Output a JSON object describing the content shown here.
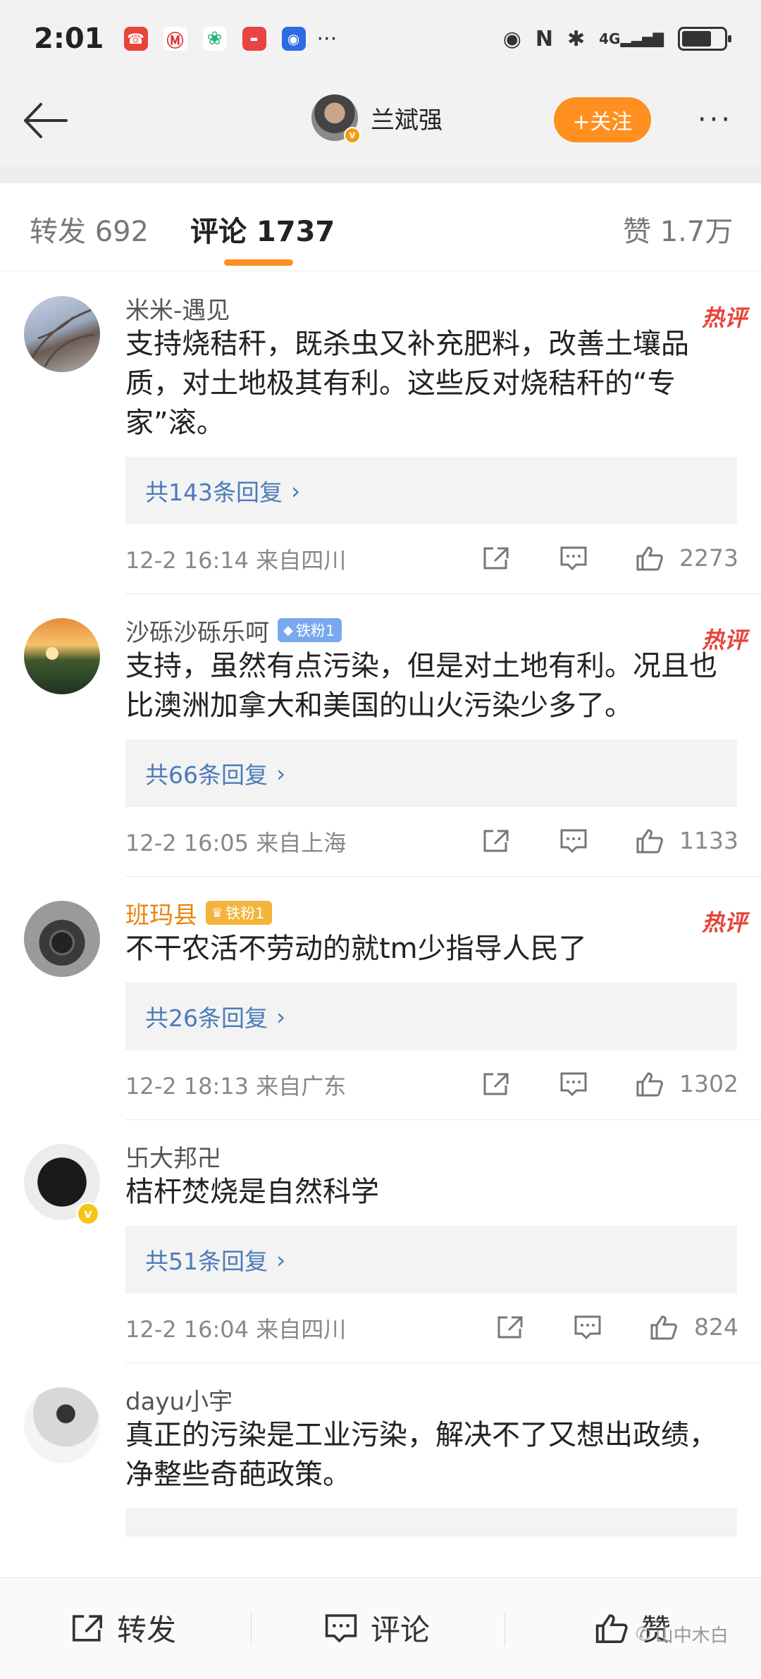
{
  "status_bar": {
    "time": "2:01",
    "network": "4G",
    "dots": "···"
  },
  "header": {
    "user_name": "兰斌强",
    "follow_label": "+关注",
    "more": "···"
  },
  "tabs": {
    "repost": "转发 692",
    "comments": "评论 1737",
    "likes": "赞 1.7万"
  },
  "hot_label": "热评",
  "comments": [
    {
      "name": "米米-遇见",
      "badge": "",
      "text": "支持烧秸秆，既杀虫又补充肥料，改善土壤品质，对土地极其有利。这些反对烧秸秆的“专家”滚。",
      "replies": "共143条回复",
      "time": "12-2 16:14 来自四川",
      "likes": "2273"
    },
    {
      "name": "沙砾沙砾乐呵",
      "badge": "铁粉1",
      "text": "支持，虽然有点污染，但是对土地有利。况且也比澳洲加拿大和美国的山火污染少多了。",
      "replies": "共66条回复",
      "time": "12-2 16:05 来自上海",
      "likes": "1133"
    },
    {
      "name": "班玛县",
      "badge": "铁粉1",
      "text": "不干农活不劳动的就tm少指导人民了",
      "replies": "共26条回复",
      "time": "12-2 18:13 来自广东",
      "likes": "1302"
    },
    {
      "name": "卐大邦卍",
      "badge": "",
      "text": "桔杆焚烧是自然科学",
      "replies": "共51条回复",
      "time": "12-2 16:04 来自四川",
      "likes": "824"
    },
    {
      "name": "dayu小宇",
      "badge": "",
      "text": "真正的污染是工业污染，解决不了又想出政绩，净整些奇葩政策。"
    }
  ],
  "bottom_bar": {
    "repost": "转发",
    "comment": "评论",
    "like": "赞"
  },
  "watermark": "山中木白",
  "colors": {
    "accent": "#ff8f1f",
    "link": "#4c7bb8",
    "hot": "#e8433a",
    "gold_name": "#e8850c"
  }
}
